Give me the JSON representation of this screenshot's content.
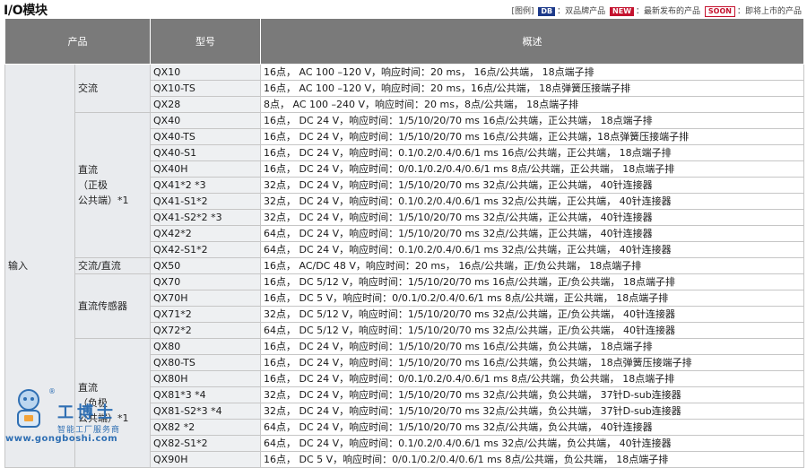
{
  "title": "I/O模块",
  "legend": {
    "prefix": "[图例]",
    "db_tag": "DB",
    "db_text": "：双品牌产品",
    "new_tag": "NEW",
    "new_text": "：最新发布的产品",
    "soon_tag": "SOON",
    "soon_text": "：即将上市的产品"
  },
  "table": {
    "headers": [
      "产品",
      "型号",
      "概述"
    ],
    "category": "输入",
    "groups": [
      {
        "label": "交流",
        "rows": [
          {
            "model": "QX10",
            "desc": "16点， AC 100 –120 V，响应时间：20 ms， 16点/公共端， 18点端子排"
          },
          {
            "model": "QX10-TS",
            "desc": "16点， AC 100 –120 V，响应时间：20 ms，16点/公共端， 18点弹簧压接端子排"
          },
          {
            "model": "QX28",
            "desc": "8点， AC 100 –240 V，响应时间：20 ms，8点/公共端， 18点端子排"
          }
        ]
      },
      {
        "label": "直流\n（正极\n公共端）*1",
        "rows": [
          {
            "model": "QX40",
            "desc": "16点， DC 24 V，响应时间：1/5/10/20/70 ms 16点/公共端，正公共端， 18点端子排"
          },
          {
            "model": "QX40-TS",
            "desc": "16点， DC 24 V，响应时间：1/5/10/20/70 ms 16点/公共端，正公共端，18点弹簧压接端子排"
          },
          {
            "model": "QX40-S1",
            "desc": "16点， DC 24 V，响应时间：0.1/0.2/0.4/0.6/1 ms 16点/公共端，正公共端， 18点端子排"
          },
          {
            "model": "QX40H",
            "desc": "16点， DC 24 V，响应时间：0/0.1/0.2/0.4/0.6/1 ms 8点/公共端，正公共端， 18点端子排"
          },
          {
            "model": "QX41*2 *3",
            "desc": "32点， DC 24 V，响应时间：1/5/10/20/70 ms 32点/公共端，正公共端， 40针连接器"
          },
          {
            "model": "QX41-S1*2",
            "desc": "32点， DC 24 V，响应时间：0.1/0.2/0.4/0.6/1 ms 32点/公共端，正公共端， 40针连接器"
          },
          {
            "model": "QX41-S2*2 *3",
            "desc": "32点， DC 24 V，响应时间：1/5/10/20/70 ms 32点/公共端，正公共端， 40针连接器"
          },
          {
            "model": "QX42*2",
            "desc": "64点， DC 24 V，响应时间：1/5/10/20/70 ms 32点/公共端，正公共端， 40针连接器"
          },
          {
            "model": "QX42-S1*2",
            "desc": "64点， DC 24 V，响应时间：0.1/0.2/0.4/0.6/1 ms 32点/公共端，正公共端， 40针连接器"
          }
        ]
      },
      {
        "label": "交流/直流",
        "rows": [
          {
            "model": "QX50",
            "desc": "16点， AC/DC 48 V，响应时间：20 ms， 16点/公共端，正/负公共端， 18点端子排"
          }
        ]
      },
      {
        "label": "直流传感器",
        "rows": [
          {
            "model": "QX70",
            "desc": "16点， DC 5/12 V，响应时间：1/5/10/20/70 ms 16点/公共端，正/负公共端， 18点端子排"
          },
          {
            "model": "QX70H",
            "desc": "16点， DC 5 V，响应时间：0/0.1/0.2/0.4/0.6/1 ms 8点/公共端，正公共端， 18点端子排"
          },
          {
            "model": "QX71*2",
            "desc": "32点， DC 5/12 V，响应时间：1/5/10/20/70 ms 32点/公共端，正/负公共端， 40针连接器"
          },
          {
            "model": "QX72*2",
            "desc": "64点， DC 5/12 V，响应时间：1/5/10/20/70 ms 32点/公共端，正/负公共端， 40针连接器"
          }
        ]
      },
      {
        "label": "直流\n（负极\n公共端）*1",
        "rows": [
          {
            "model": "QX80",
            "desc": "16点， DC 24 V，响应时间：1/5/10/20/70 ms 16点/公共端，负公共端， 18点端子排"
          },
          {
            "model": "QX80-TS",
            "desc": "16点， DC 24 V，响应时间：1/5/10/20/70 ms 16点/公共端，负公共端， 18点弹簧压接端子排"
          },
          {
            "model": "QX80H",
            "desc": "16点， DC 24 V，响应时间：0/0.1/0.2/0.4/0.6/1 ms 8点/公共端，负公共端， 18点端子排"
          },
          {
            "model": "QX81*3 *4",
            "desc": "32点， DC 24 V，响应时间：1/5/10/20/70 ms 32点/公共端，负公共端， 37针D-sub连接器"
          },
          {
            "model": "QX81-S2*3 *4",
            "desc": "32点， DC 24 V，响应时间：1/5/10/20/70 ms 32点/公共端，负公共端， 37针D-sub连接器"
          },
          {
            "model": "QX82 *2",
            "desc": "64点， DC 24 V，响应时间：1/5/10/20/70 ms 32点/公共端，负公共端， 40针连接器"
          },
          {
            "model": "QX82-S1*2",
            "desc": "64点， DC 24 V，响应时间：0.1/0.2/0.4/0.6/1 ms 32点/公共端，负公共端， 40针连接器"
          },
          {
            "model": "QX90H",
            "desc": "16点， DC 5 V，响应时间：0/0.1/0.2/0.4/0.6/1 ms 8点/公共端，负公共端， 18点端子排"
          }
        ]
      }
    ]
  },
  "watermark": {
    "brand": "工博士",
    "tagline": "智能工厂服务商",
    "url": "www.gongboshi.com",
    "reg_mark": "®"
  },
  "colors": {
    "header_bg": "#7a7a7a",
    "label_bg": "#e9ebee",
    "db_tag": "#1d3a8a",
    "new_tag": "#c4122e",
    "watermark": "#2f6fb3"
  }
}
